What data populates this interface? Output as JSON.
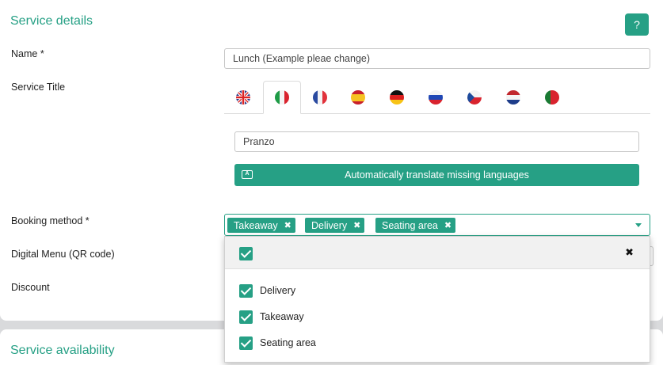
{
  "service_details": {
    "title": "Service details",
    "help_label": "?",
    "name_label": "Name *",
    "name_value": "Lunch (Example pleae change)",
    "service_title_label": "Service Title",
    "service_title_value": "Pranzo",
    "translate_label": "Automatically translate missing languages",
    "booking_label": "Booking method *",
    "digital_menu_label": "Digital Menu (QR code)",
    "discount_label": "Discount"
  },
  "tabs": [
    {
      "flag": "uk-flag"
    },
    {
      "flag": "italy-flag",
      "active": true
    },
    {
      "flag": "france-flag"
    },
    {
      "flag": "spain-flag"
    },
    {
      "flag": "germany-flag"
    },
    {
      "flag": "russia-flag"
    },
    {
      "flag": "czech-flag"
    },
    {
      "flag": "netherlands-flag"
    },
    {
      "flag": "portugal-flag"
    }
  ],
  "booking_tags": [
    "Takeaway",
    "Delivery",
    "Seating area"
  ],
  "dropdown": {
    "options": [
      "Delivery",
      "Takeaway",
      "Seating area"
    ]
  },
  "service_availability": {
    "title": "Service availability"
  },
  "colors": {
    "accent": "#26a085"
  }
}
